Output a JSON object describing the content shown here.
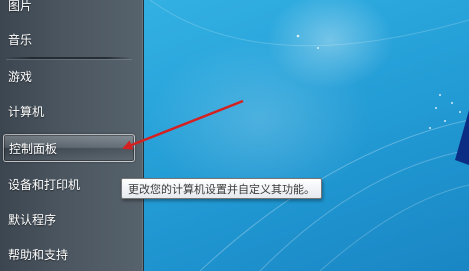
{
  "start_menu": {
    "items": [
      {
        "label": "图片"
      },
      {
        "label": "音乐"
      },
      {
        "label": "游戏"
      },
      {
        "label": "计算机"
      },
      {
        "label": "控制面板"
      },
      {
        "label": "设备和打印机"
      },
      {
        "label": "默认程序"
      },
      {
        "label": "帮助和支持"
      }
    ]
  },
  "tooltip": {
    "text": "更改您的计算机设置并自定义其功能。"
  },
  "colors": {
    "desktop_blue": "#2aa6dc",
    "arrow_red": "#d42020",
    "menu_panel": "#4b5660"
  }
}
